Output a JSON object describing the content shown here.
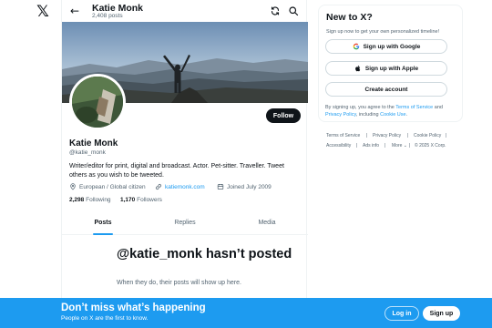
{
  "nav": {
    "logo_glyph": "𝕏",
    "logo_icon": "x-logo-icon"
  },
  "header": {
    "back_icon": "arrow-left-icon",
    "back_glyph": "←",
    "name": "Katie Monk",
    "posts_count": "2,408 posts",
    "refresh_icon": "refresh-icon",
    "search_icon": "search-icon"
  },
  "profile": {
    "follow_label": "Follow",
    "name": "Katie Monk",
    "handle": "@katie_monk",
    "bio": "Writer/editor for print, digital and broadcast. Actor. Pet-sitter. Traveller. Tweet others as you wish to be tweeted.",
    "location": "European / Global citizen",
    "website": "katiemonk.com",
    "joined": "Joined July 2009",
    "following_count": "2,298",
    "following_label": "Following",
    "followers_count": "1,170",
    "followers_label": "Followers"
  },
  "tabs": [
    {
      "label": "Posts",
      "active": true
    },
    {
      "label": "Replies",
      "active": false
    },
    {
      "label": "Media",
      "active": false
    }
  ],
  "empty_state": {
    "title": "@katie_monk hasn’t posted",
    "subtitle": "When they do, their posts will show up here."
  },
  "signup_card": {
    "title": "New to X?",
    "subtitle": "Sign up now to get your own personalized timeline!",
    "google_label": "Sign up with Google",
    "apple_label": "Sign up with Apple",
    "create_label": "Create account",
    "terms_prefix": "By signing up, you agree to the",
    "terms_link": "Terms of Service",
    "terms_and": "and",
    "privacy_link": "Privacy Policy",
    "terms_including": ", including",
    "cookie_link": "Cookie Use",
    "terms_end": "."
  },
  "footer": {
    "links": [
      "Terms of Service",
      "Privacy Policy",
      "Cookie Policy",
      "Accessibility",
      "Ads info",
      "More"
    ],
    "more_glyph": "⌄",
    "copyright": "© 2025 X Corp.",
    "separator": "|"
  },
  "bottom_bar": {
    "title": "Don’t miss what’s happening",
    "subtitle": "People on X are the first to know.",
    "login_label": "Log in",
    "signup_label": "Sign up"
  },
  "colors": {
    "accent": "#1d9bf0",
    "text": "#0f1419",
    "secondary": "#536471",
    "border": "#eff3f4"
  }
}
